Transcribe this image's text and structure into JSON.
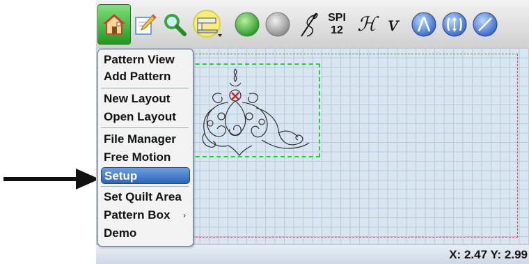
{
  "toolbar": {
    "spi_label": "SPI",
    "spi_value": "12",
    "h_symbol": "ℋ",
    "v_symbol": "ᴠ"
  },
  "menu": {
    "items": [
      {
        "label": "Pattern View"
      },
      {
        "label": "Add Pattern"
      },
      {
        "label": "New Layout"
      },
      {
        "label": "Open Layout"
      },
      {
        "label": "File Manager"
      },
      {
        "label": "Free Motion"
      },
      {
        "label": "Setup"
      },
      {
        "label": "Set Quilt Area"
      },
      {
        "label": "Pattern Box"
      },
      {
        "label": "Demo"
      }
    ],
    "submenu_glyph": "›",
    "selected_index": 6
  },
  "status": {
    "coords": "X: 2.47 Y: 2.99"
  },
  "colors": {
    "accent_selected": "#3a72c8",
    "pattern_box_outline": "#2ecc40",
    "quilt_area_outline": "#e0404a",
    "canvas_bg": "#d9e6f2"
  }
}
